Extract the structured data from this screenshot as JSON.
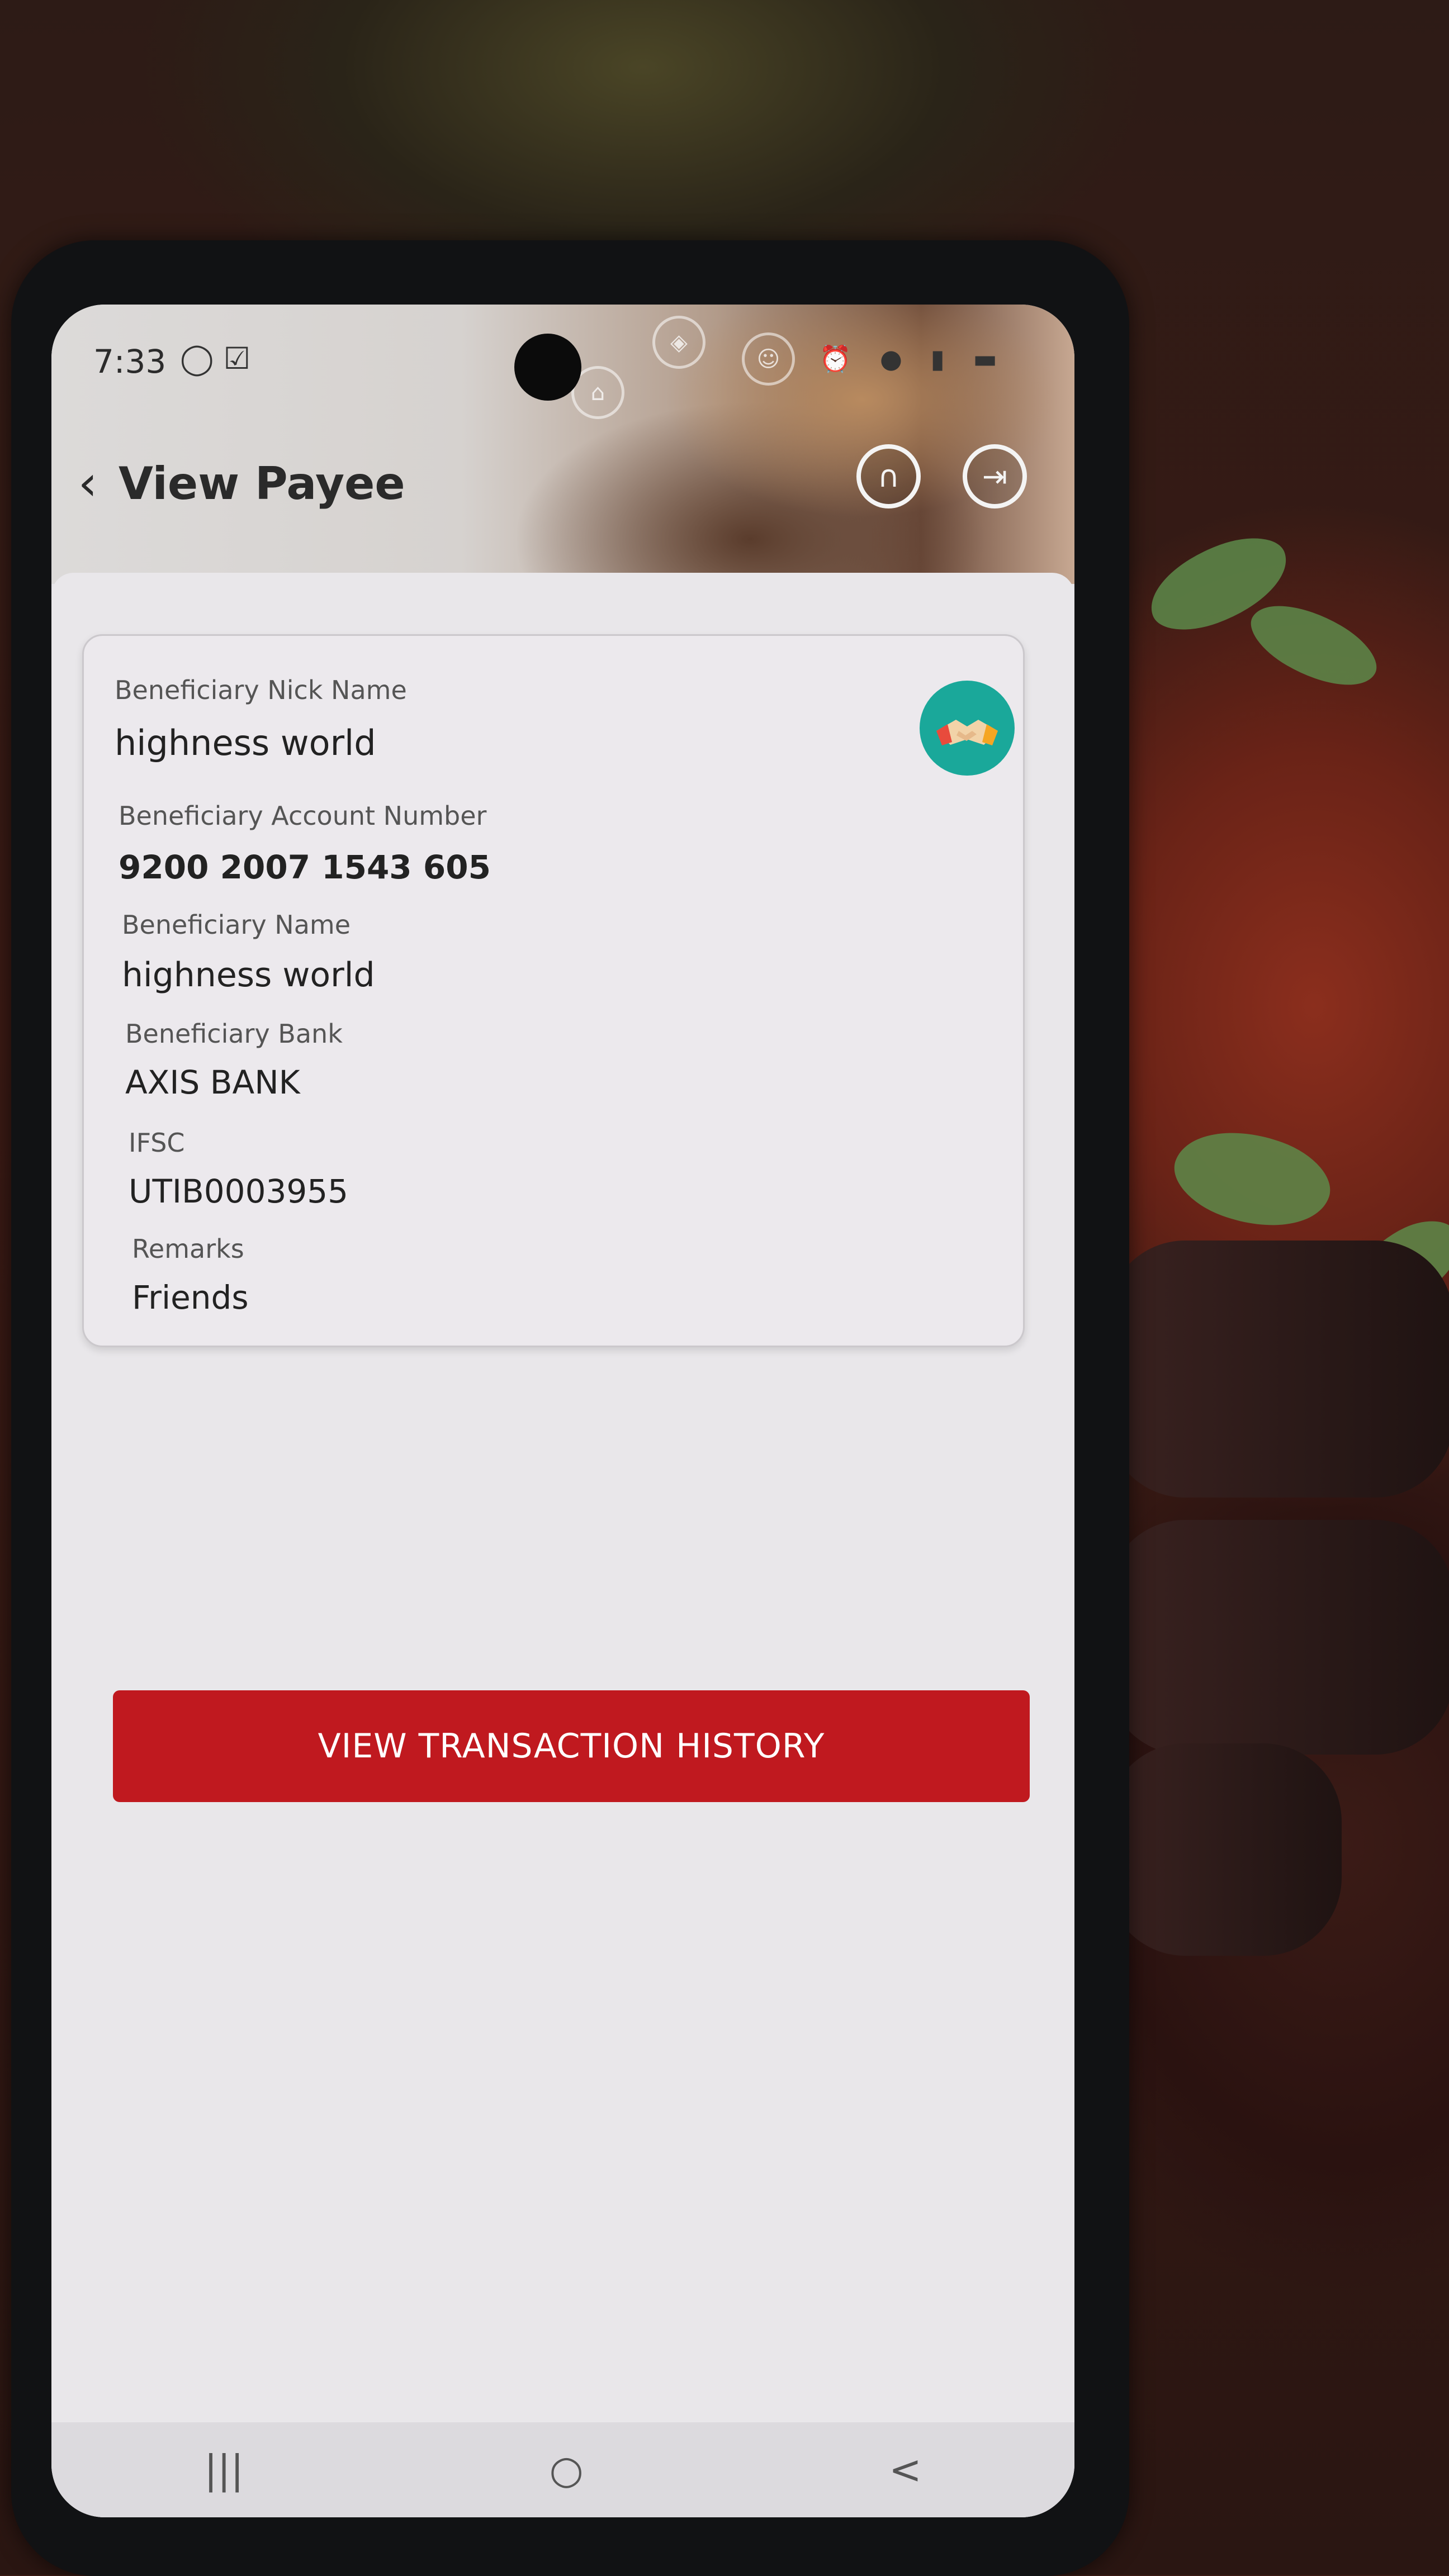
{
  "status_bar": {
    "time": "7:33",
    "left_icons": [
      "whatsapp-icon",
      "check-square-icon"
    ],
    "right_icons": [
      "alarm-icon",
      "location-icon",
      "signal-icon",
      "battery-icon"
    ]
  },
  "header": {
    "title": "View Payee",
    "back_icon": "‹",
    "support_icon": "headset-icon",
    "logout_icon": "logout-icon"
  },
  "payee": {
    "nick_name_label": "Beneficiary Nick Name",
    "nick_name": "highness world",
    "account_number_label": "Beneficiary Account Number",
    "account_number": "9200 2007 1543 605",
    "name_label": "Beneficiary Name",
    "name": "highness world",
    "bank_label": "Beneficiary Bank",
    "bank": "AXIS BANK",
    "ifsc_label": "IFSC",
    "ifsc": "UTIB0003955",
    "remarks_label": "Remarks",
    "remarks": "Friends",
    "avatar_icon": "handshake-icon"
  },
  "actions": {
    "view_history_label": "VIEW TRANSACTION HISTORY"
  },
  "navbar": {
    "recents": "|||",
    "home": "○",
    "back": "<"
  },
  "colors": {
    "accent_red": "#c0191f",
    "avatar_teal": "#1aa89a"
  }
}
